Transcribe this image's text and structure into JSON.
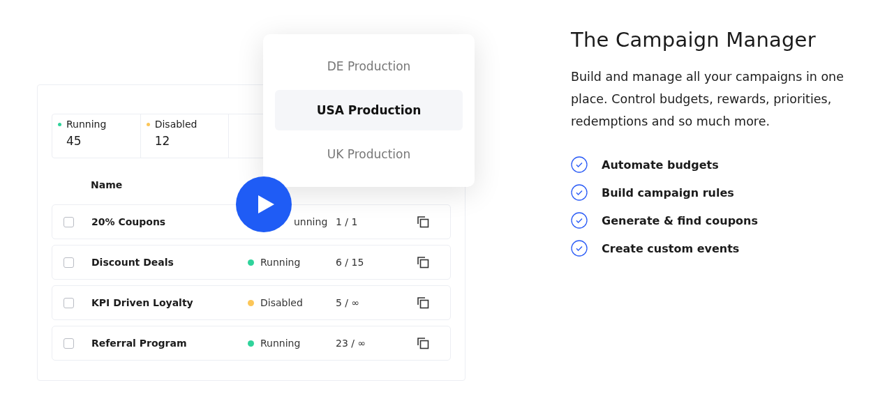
{
  "stats": [
    {
      "label": "Running",
      "value": "45",
      "color": "#2fd39b"
    },
    {
      "label": "Disabled",
      "value": "12",
      "color": "#fcc658"
    }
  ],
  "table": {
    "columns": [
      "Name"
    ],
    "rows": [
      {
        "checked": false,
        "name": "20% Coupons",
        "status": "unning",
        "coupon": "1 / 1"
      },
      {
        "checked": false,
        "name": "Discount Deals",
        "status": "Running",
        "color": "#2fd39b",
        "coupon": "6 / 15"
      },
      {
        "checked": false,
        "name": "KPI Driven Loyalty",
        "status": "Disabled",
        "color": "#fcc658",
        "coupon": "5 / ∞"
      },
      {
        "checked": false,
        "name": "Referral Program",
        "status": "Running",
        "color": "#2fd39b",
        "coupon": "23 / ∞"
      }
    ]
  },
  "dropdown": {
    "items": [
      {
        "label": "DE Production",
        "selected": false
      },
      {
        "label": "USA Production",
        "selected": true
      },
      {
        "label": "UK Production",
        "selected": false
      }
    ]
  },
  "feature": {
    "title": "The Campaign Manager",
    "description": "Build and manage all your campaigns in one place. Control budgets, rewards, priorities, redemptions and so much more.",
    "bullets": [
      "Automate budgets",
      "Build campaign rules",
      "Generate & find coupons",
      "Create custom events"
    ]
  }
}
